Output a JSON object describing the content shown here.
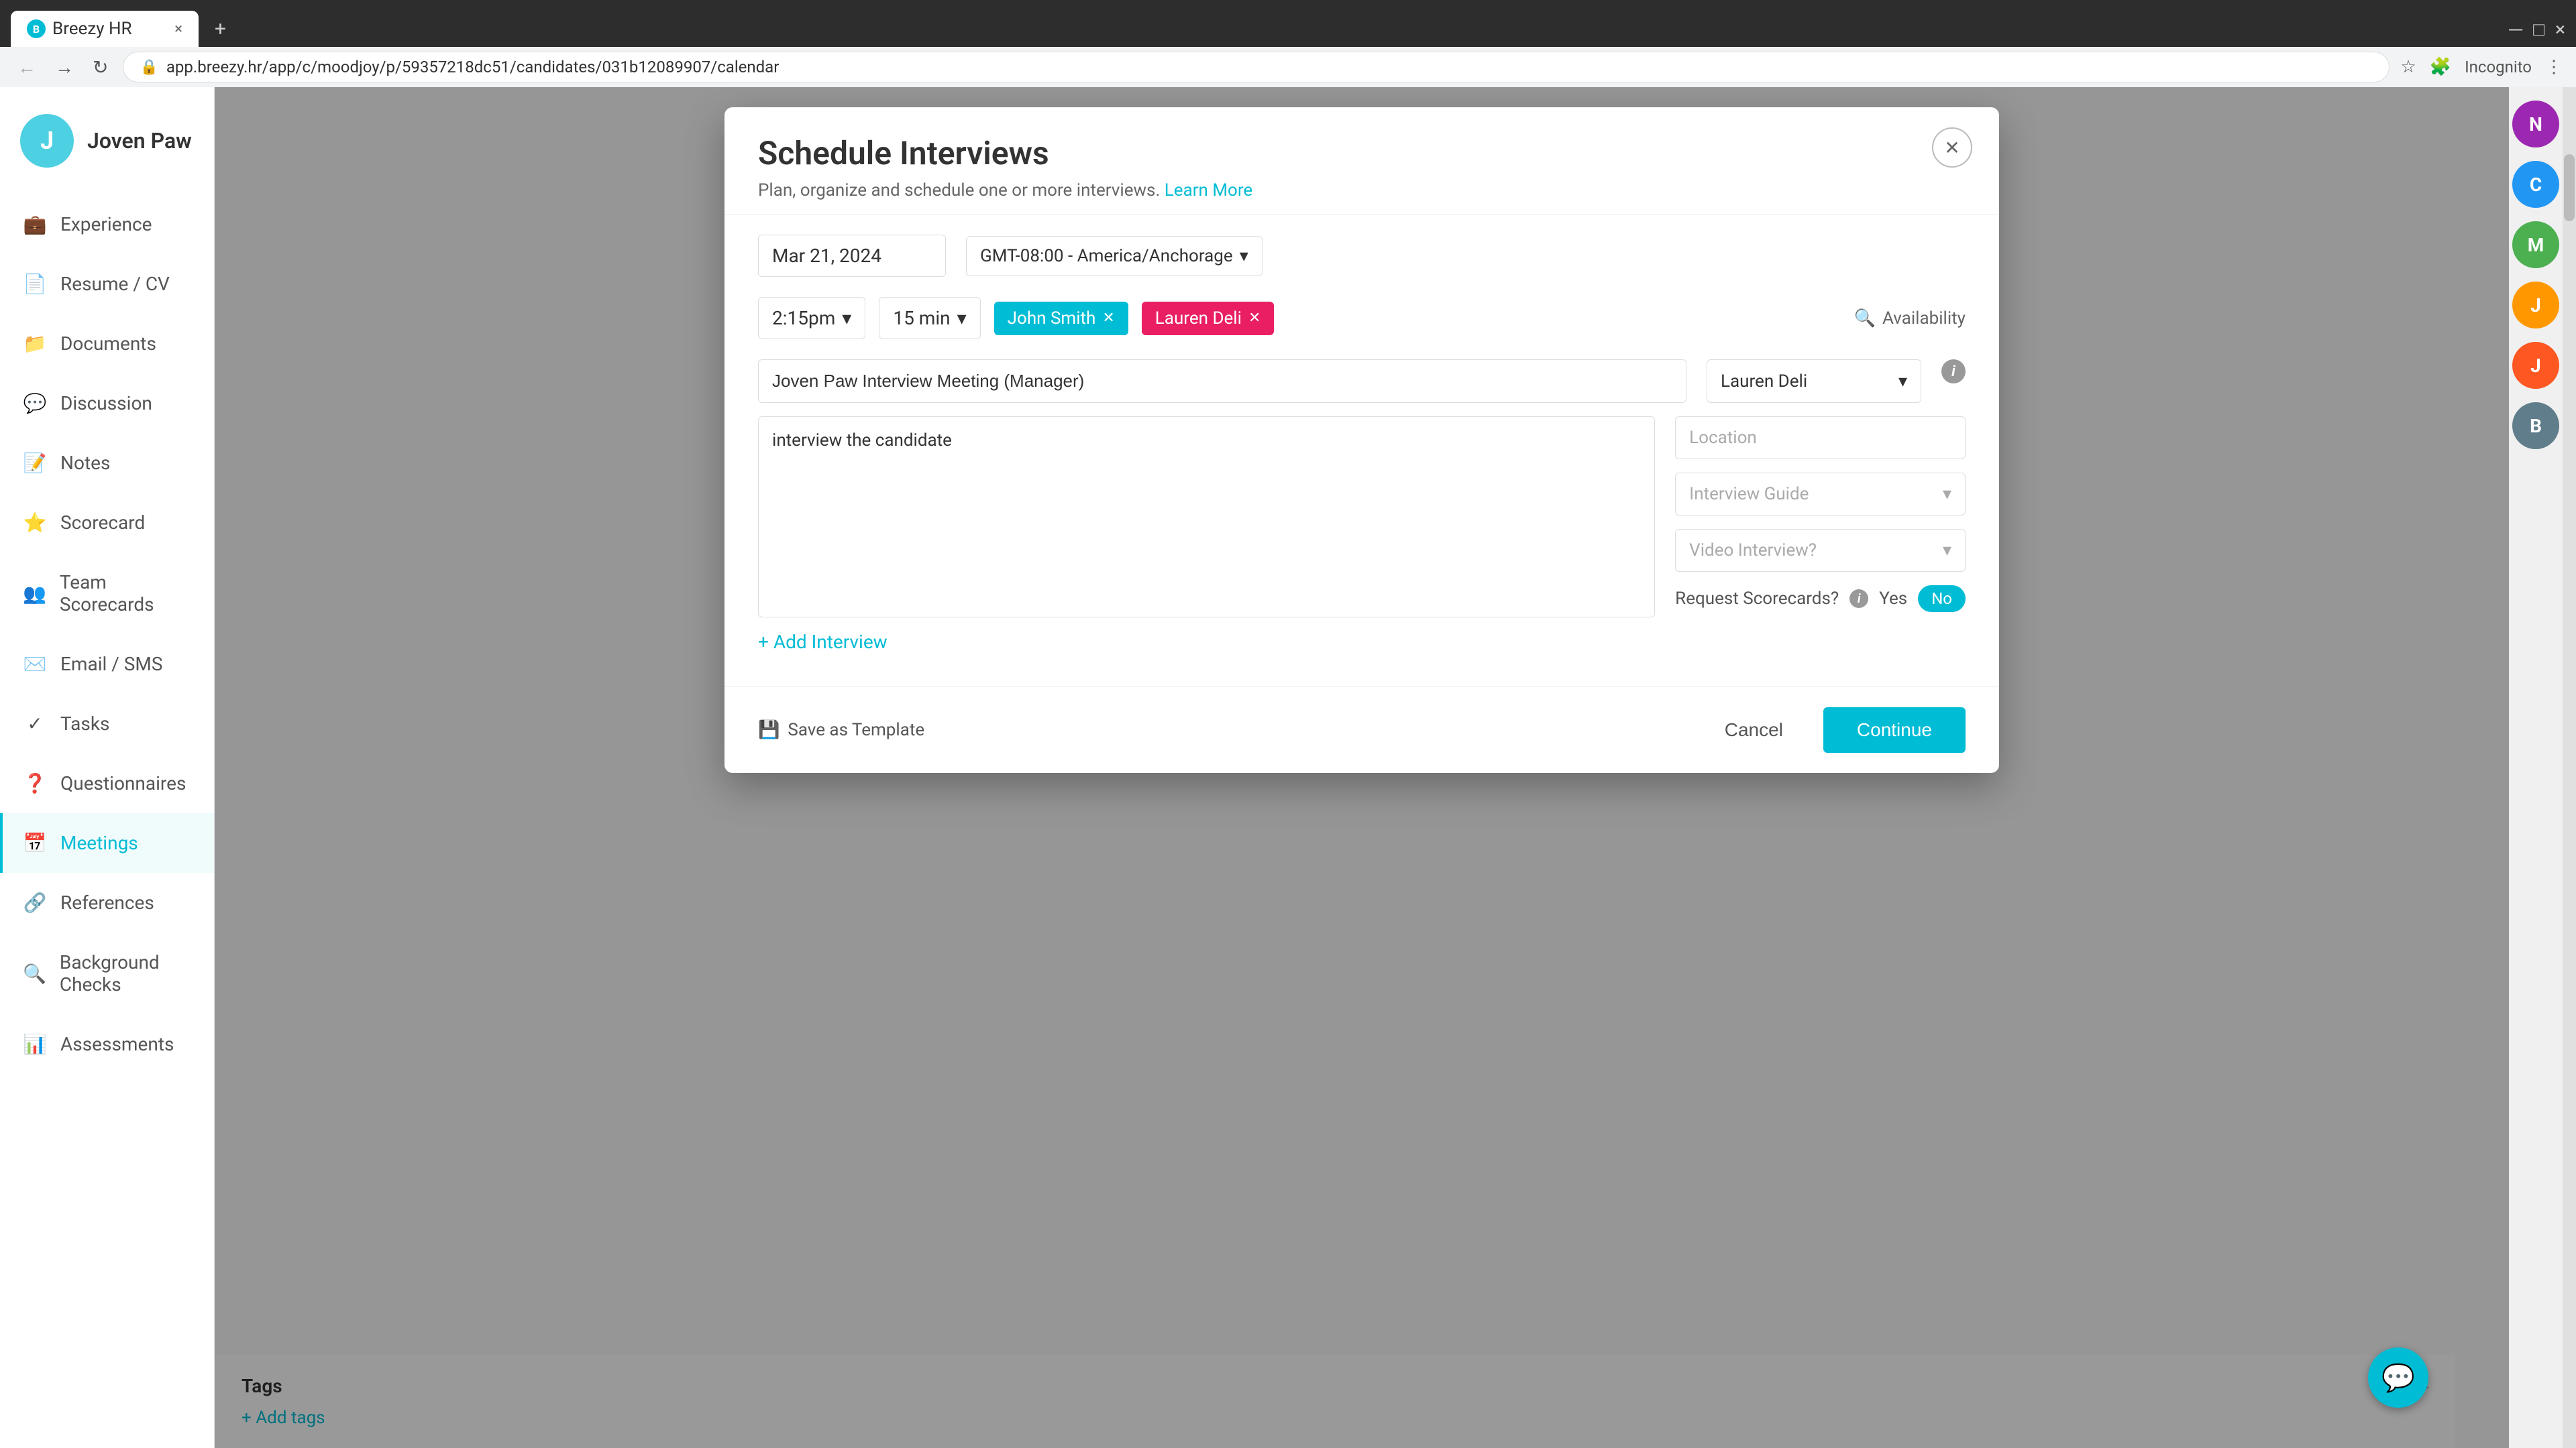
{
  "browser": {
    "tab_label": "Breezy HR",
    "url": "app.breezy.hr/app/c/moodjoy/p/59357218dc51/candidates/031b12089907/calendar",
    "incognito_label": "Incognito"
  },
  "sidebar": {
    "user_initial": "J",
    "user_name": "Joven Paw",
    "nav_items": [
      {
        "id": "experience",
        "label": "Experience",
        "icon": "💼"
      },
      {
        "id": "resume",
        "label": "Resume / CV",
        "icon": "📄"
      },
      {
        "id": "documents",
        "label": "Documents",
        "icon": "📁"
      },
      {
        "id": "discussion",
        "label": "Discussion",
        "icon": "💬"
      },
      {
        "id": "notes",
        "label": "Notes",
        "icon": "📝"
      },
      {
        "id": "scorecard",
        "label": "Scorecard",
        "icon": "⭐"
      },
      {
        "id": "team-scorecards",
        "label": "Team Scorecards",
        "icon": "👥"
      },
      {
        "id": "email-sms",
        "label": "Email / SMS",
        "icon": "✉️"
      },
      {
        "id": "tasks",
        "label": "Tasks",
        "icon": "✓"
      },
      {
        "id": "questionnaires",
        "label": "Questionnaires",
        "icon": "❓"
      },
      {
        "id": "meetings",
        "label": "Meetings",
        "icon": "📅"
      },
      {
        "id": "references",
        "label": "References",
        "icon": "🔗"
      },
      {
        "id": "background-checks",
        "label": "Background Checks",
        "icon": "🔍"
      },
      {
        "id": "assessments",
        "label": "Assessments",
        "icon": "📊"
      }
    ]
  },
  "modal": {
    "title": "Schedule Interviews",
    "subtitle": "Plan, organize and schedule one or more interviews.",
    "learn_more_label": "Learn More",
    "close_label": "×",
    "date": "Mar 21, 2024",
    "timezone": "GMT-08:00 - America/Anchorage",
    "time": "2:15pm",
    "duration": "15 min",
    "interviewers": [
      {
        "name": "John Smith",
        "color": "cyan"
      },
      {
        "name": "Lauren Deli",
        "color": "pink"
      }
    ],
    "availability_label": "Availability",
    "meeting_title": "Joven Paw Interview Meeting (Manager)",
    "notes_placeholder": "interview the candidate",
    "notes_value": "interview the candidate",
    "interviewer_selected": "Lauren Deli",
    "location_placeholder": "Location",
    "interview_guide_placeholder": "Interview Guide",
    "video_interview_placeholder": "Video Interview?",
    "request_scorecards_label": "Request Scorecards?",
    "yes_label": "Yes",
    "no_label": "No",
    "add_interview_label": "+ Add Interview",
    "save_template_label": "Save as Template",
    "cancel_label": "Cancel",
    "continue_label": "Continue"
  },
  "right_panel": {
    "avatars": [
      "N",
      "C",
      "M",
      "J",
      "J",
      "B"
    ]
  },
  "tags_section": {
    "title": "Tags",
    "add_tags_label": "+ Add tags"
  },
  "chat_fab": {
    "icon": "💬"
  }
}
